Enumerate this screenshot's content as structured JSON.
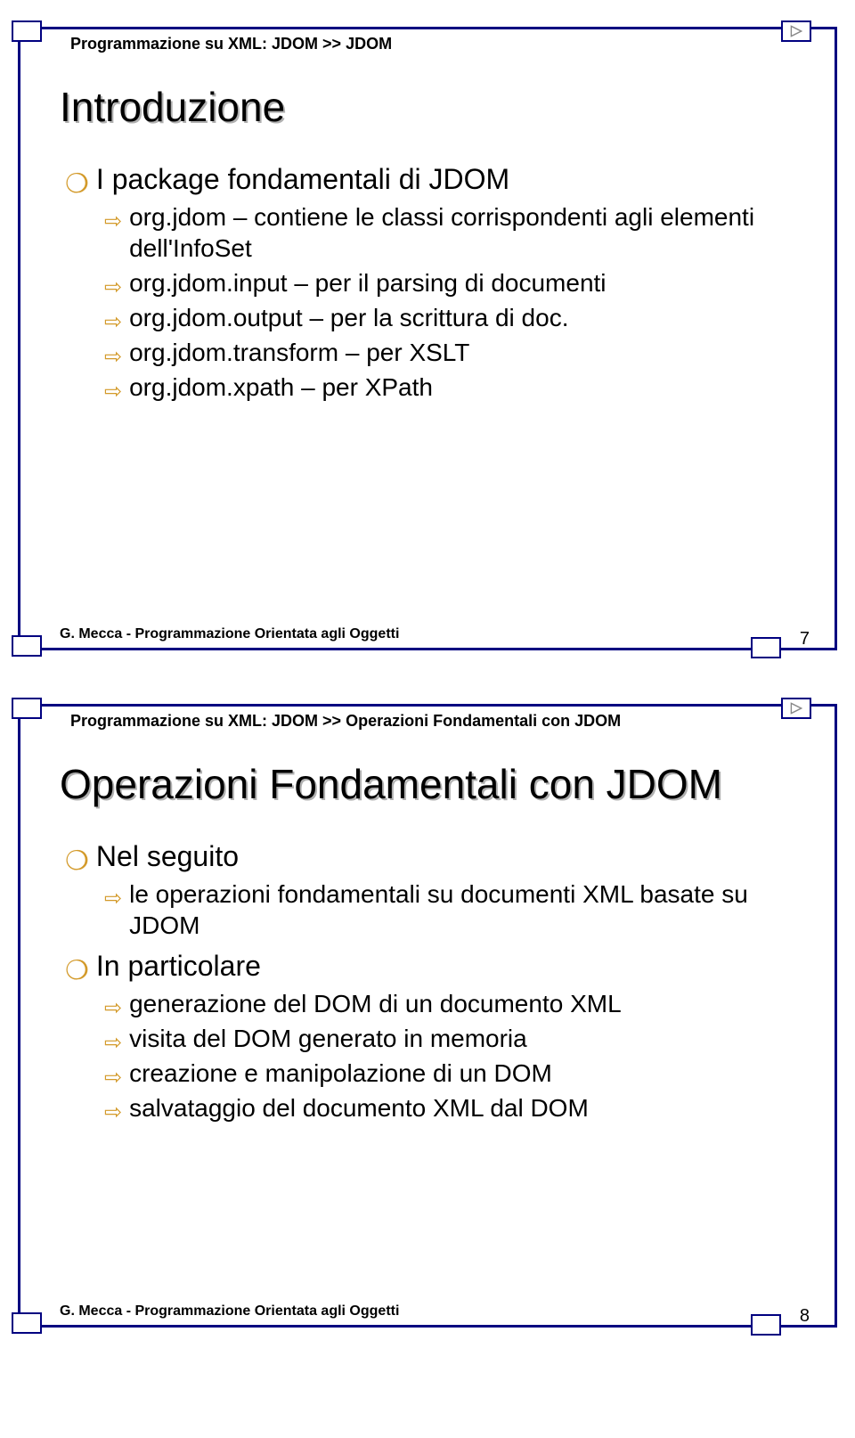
{
  "slide1": {
    "breadcrumb": "Programmazione su XML: JDOM >> JDOM",
    "title": "Introduzione",
    "level1_0": "I package fondamentali di JDOM",
    "items": {
      "i0": "org.jdom – contiene le classi corrispondenti agli elementi dell'InfoSet",
      "i1": "org.jdom.input – per il parsing di documenti",
      "i2": "org.jdom.output – per la scrittura di doc.",
      "i3": "org.jdom.transform – per XSLT",
      "i4": "org.jdom.xpath – per XPath"
    },
    "footer": "G. Mecca - Programmazione Orientata agli Oggetti",
    "page": "7"
  },
  "slide2": {
    "breadcrumb": "Programmazione su XML: JDOM >> Operazioni Fondamentali con JDOM",
    "title": "Operazioni Fondamentali con JDOM",
    "level1_0": "Nel seguito",
    "items_a": {
      "i0": "le operazioni fondamentali su documenti XML basate su JDOM"
    },
    "level1_1": "In particolare",
    "items_b": {
      "i0": "generazione del DOM di un documento XML",
      "i1": "visita del DOM generato in memoria",
      "i2": "creazione e manipolazione di un DOM",
      "i3": "salvataggio del documento XML dal DOM"
    },
    "footer": "G. Mecca - Programmazione Orientata agli Oggetti",
    "page": "8"
  }
}
